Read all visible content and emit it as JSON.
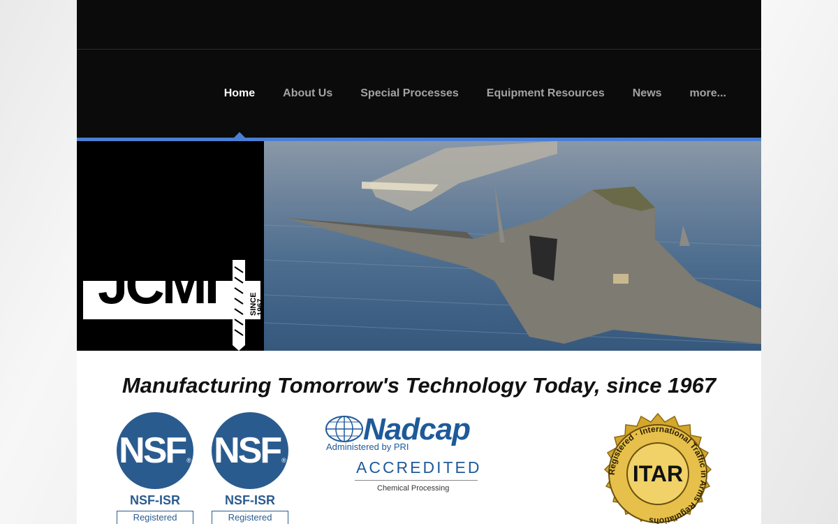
{
  "nav": {
    "items": [
      {
        "label": "Home",
        "active": true
      },
      {
        "label": "About Us",
        "active": false
      },
      {
        "label": "Special Processes",
        "active": false
      },
      {
        "label": "Equipment Resources",
        "active": false
      },
      {
        "label": "News",
        "active": false
      },
      {
        "label": "more...",
        "active": false
      }
    ]
  },
  "logo": {
    "letters": "JCMI",
    "since": "SINCE",
    "year": "1967"
  },
  "tagline": "Manufacturing Tomorrow's Technology Today, since 1967",
  "certifications": {
    "nsf": [
      {
        "mark": "NSF",
        "label": "NSF-ISR",
        "box": "Registered"
      },
      {
        "mark": "NSF",
        "label": "NSF-ISR",
        "box": "Registered"
      }
    ],
    "nadcap": {
      "word": "Nadcap",
      "admin": "Administered by PRI",
      "accredited": "ACCREDITED",
      "scope": "Chemical Processing"
    },
    "itar": {
      "center": "ITAR",
      "ring": "Registered · International Traffic in Arms Regulations"
    }
  },
  "colors": {
    "accent": "#4a7fd4",
    "nsf_blue": "#2a5b8f",
    "nadcap_blue": "#1e5a9a",
    "itar_gold": "#d4a72c"
  }
}
